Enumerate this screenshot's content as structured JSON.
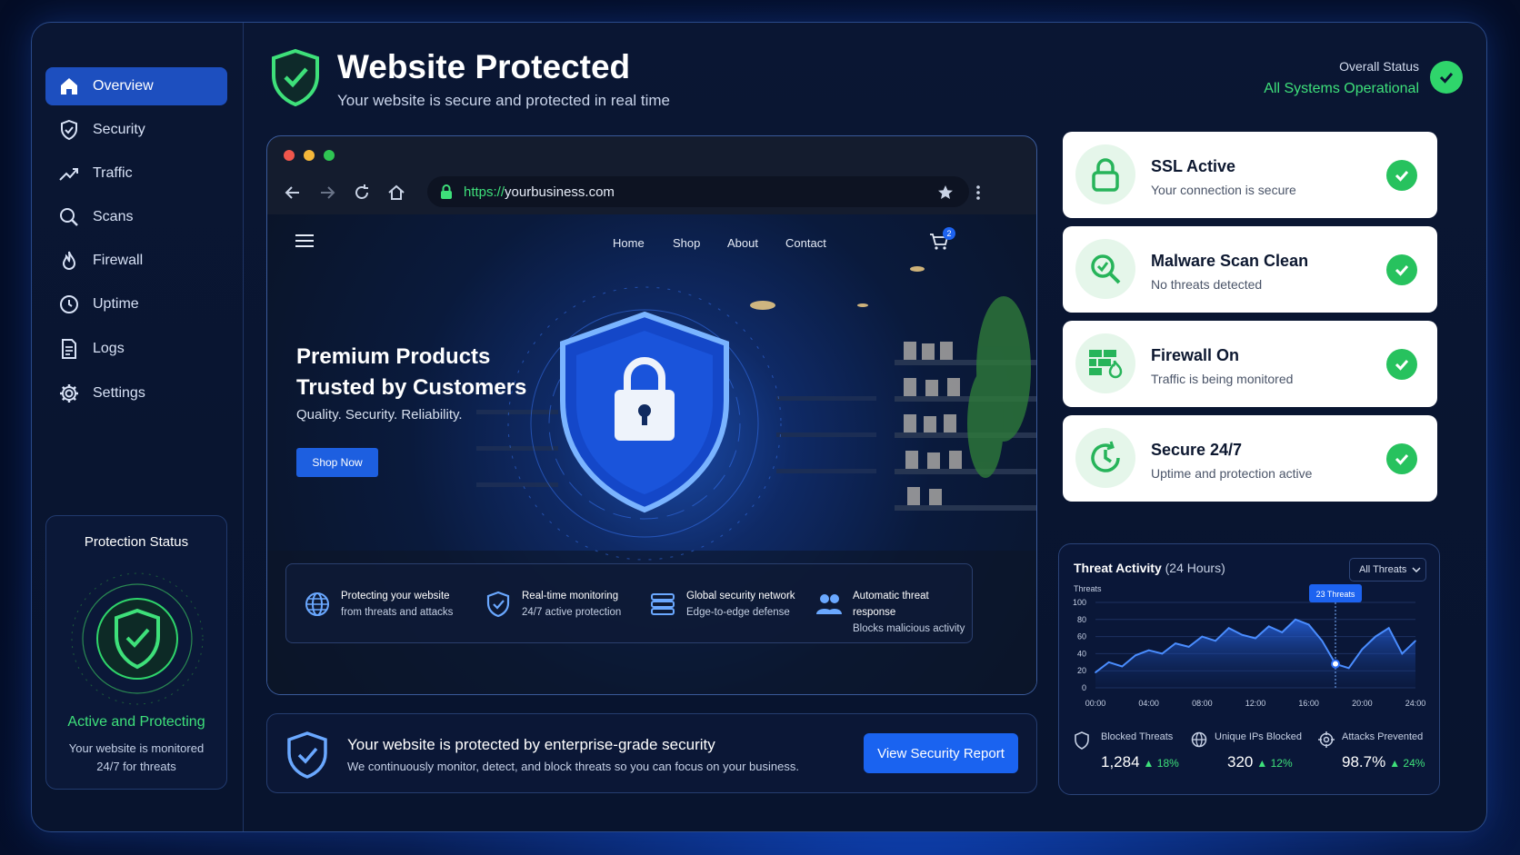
{
  "sidebar": {
    "items": [
      {
        "label": "Overview",
        "icon": "home-icon"
      },
      {
        "label": "Security",
        "icon": "shield-icon"
      },
      {
        "label": "Traffic",
        "icon": "trend-icon"
      },
      {
        "label": "Scans",
        "icon": "search-icon"
      },
      {
        "label": "Firewall",
        "icon": "flame-icon"
      },
      {
        "label": "Uptime",
        "icon": "clock-icon"
      },
      {
        "label": "Logs",
        "icon": "document-icon"
      },
      {
        "label": "Settings",
        "icon": "gear-icon"
      }
    ],
    "protection": {
      "title": "Protection Status",
      "status": "Active and Protecting",
      "line1": "Your website is monitored",
      "line2": "24/7 for threats"
    }
  },
  "header": {
    "title": "Website Protected",
    "subtitle": "Your website is secure and protected in real time",
    "overall_label": "Overall Status",
    "overall_value": "All Systems Operational"
  },
  "browser": {
    "url_scheme": "https://",
    "url_host": "yourbusiness.com",
    "cart_count": "2",
    "nav": [
      "Home",
      "Shop",
      "About",
      "Contact"
    ],
    "hero_line1": "Premium Products",
    "hero_line2": "Trusted by Customers",
    "tagline": "Quality. Security. Reliability.",
    "cta": "Shop Now",
    "features": [
      {
        "title": "Protecting your website",
        "sub": "from threats and attacks"
      },
      {
        "title": "Real-time monitoring",
        "sub": "24/7 active protection"
      },
      {
        "title": "Global security network",
        "sub": "Edge-to-edge defense"
      },
      {
        "title": "Automatic threat response",
        "sub": "Blocks malicious activity"
      }
    ]
  },
  "banner": {
    "title": "Your website is protected by enterprise-grade security",
    "desc": "We continuously monitor, detect, and block threats so you can focus on your business.",
    "button": "View Security Report"
  },
  "cards": [
    {
      "title": "SSL Active",
      "sub": "Your connection is secure"
    },
    {
      "title": "Malware Scan Clean",
      "sub": "No threats detected"
    },
    {
      "title": "Firewall On",
      "sub": "Traffic is being monitored"
    },
    {
      "title": "Secure 24/7",
      "sub": "Uptime and protection active"
    }
  ],
  "threat": {
    "title": "Threat Activity",
    "period": "(24 Hours)",
    "filter": "All Threats",
    "y_label": "Threats",
    "tooltip": "23 Threats",
    "stats": [
      {
        "label": "Blocked Threats",
        "value": "1,284",
        "change": "18%"
      },
      {
        "label": "Unique IPs Blocked",
        "value": "320",
        "change": "12%"
      },
      {
        "label": "Attacks Prevented",
        "value": "98.7%",
        "change": "24%"
      }
    ]
  },
  "chart_data": {
    "type": "area",
    "title": "Threat Activity",
    "ylabel": "Threats",
    "ylim": [
      0,
      100
    ],
    "y_ticks": [
      "100",
      "80",
      "60",
      "40",
      "20",
      "0"
    ],
    "x_ticks": [
      "00:00",
      "04:00",
      "08:00",
      "12:00",
      "16:00",
      "20:00",
      "24:00"
    ],
    "x": [
      0,
      1,
      2,
      3,
      4,
      5,
      6,
      7,
      8,
      9,
      10,
      11,
      12,
      13,
      14,
      15,
      16,
      17,
      18,
      19,
      20,
      21,
      22,
      23,
      24
    ],
    "values": [
      18,
      30,
      25,
      38,
      44,
      40,
      52,
      48,
      60,
      55,
      70,
      62,
      58,
      72,
      65,
      80,
      74,
      55,
      28,
      23,
      45,
      60,
      70,
      40,
      55
    ],
    "highlight": {
      "x": 18,
      "label": "23 Threats"
    }
  }
}
